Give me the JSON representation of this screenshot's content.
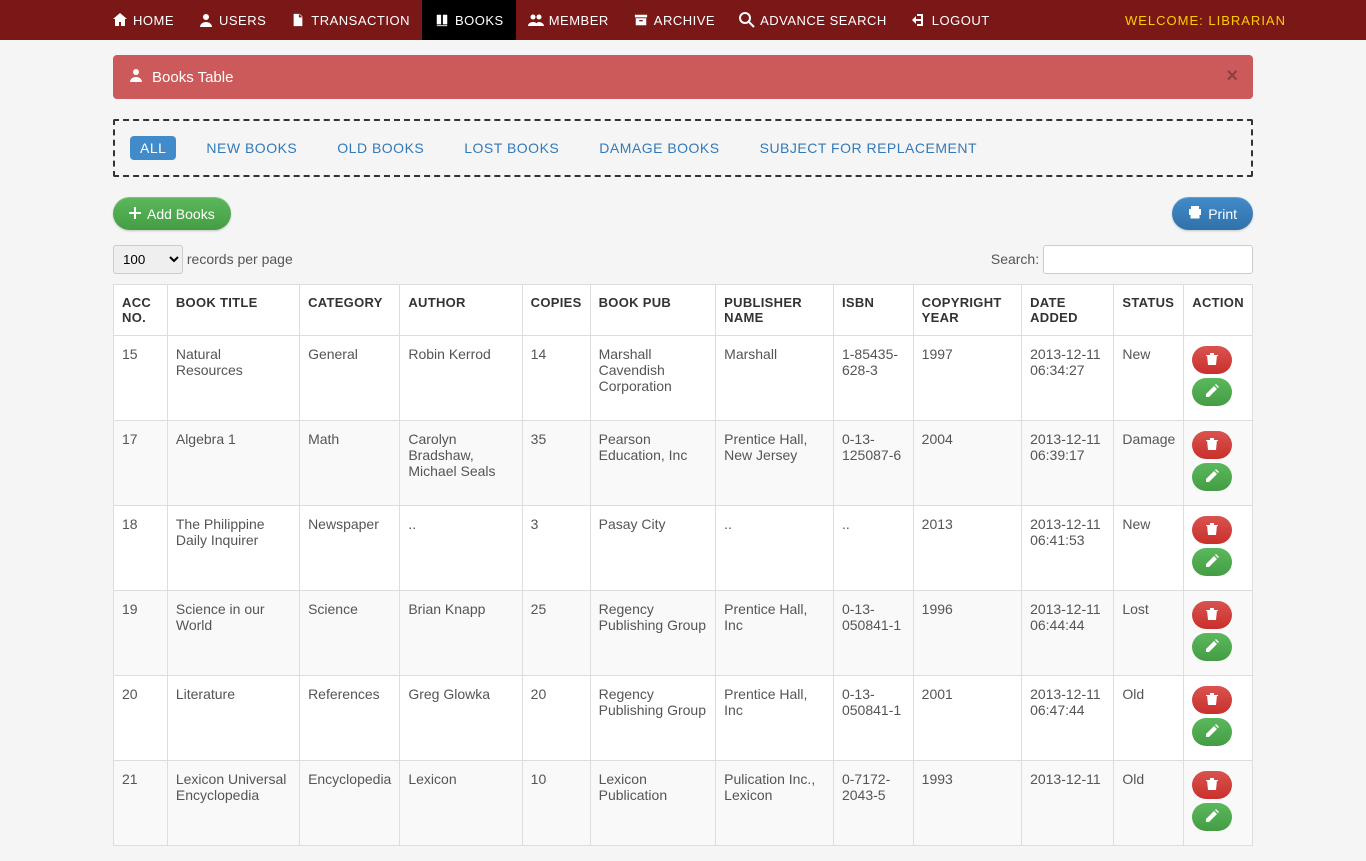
{
  "nav": {
    "home": "HOME",
    "users": "USERS",
    "transaction": "TRANSACTION",
    "books": "BOOKS",
    "member": "MEMBER",
    "archive": "ARCHIVE",
    "advance_search": "ADVANCE SEARCH",
    "logout": "LOGOUT"
  },
  "welcome": "WELCOME: LIBRARIAN",
  "panel_title": "Books Table",
  "filters": {
    "all": "ALL",
    "new_books": "NEW BOOKS",
    "old_books": "OLD BOOKS",
    "lost_books": "LOST BOOKS",
    "damage_books": "DAMAGE BOOKS",
    "subject_replacement": "SUBJECT FOR REPLACEMENT"
  },
  "buttons": {
    "add_books": "Add Books",
    "print": "Print"
  },
  "records_label": "records per page",
  "records_value": "100",
  "search_label": "Search:",
  "columns": {
    "acc_no": "ACC NO.",
    "book_title": "BOOK TITLE",
    "category": "CATEGORY",
    "author": "AUTHOR",
    "copies": "COPIES",
    "book_pub": "BOOK PUB",
    "publisher_name": "PUBLISHER NAME",
    "isbn": "ISBN",
    "copyright_year": "COPYRIGHT YEAR",
    "date_added": "DATE ADDED",
    "status": "STATUS",
    "action": "ACTION"
  },
  "rows": [
    {
      "acc": "15",
      "title": "Natural Resources",
      "cat": "General",
      "author": "Robin Kerrod",
      "copies": "14",
      "pub": "Marshall Cavendish Corporation",
      "pubname": "Marshall",
      "isbn": "1-85435-628-3",
      "year": "1997",
      "date": "2013-12-11 06:34:27",
      "status": "New"
    },
    {
      "acc": "17",
      "title": "Algebra 1",
      "cat": "Math",
      "author": "Carolyn Bradshaw, Michael Seals",
      "copies": "35",
      "pub": "Pearson Education, Inc",
      "pubname": "Prentice Hall, New Jersey",
      "isbn": "0-13-125087-6",
      "year": "2004",
      "date": "2013-12-11 06:39:17",
      "status": "Damage"
    },
    {
      "acc": "18",
      "title": "The Philippine Daily Inquirer",
      "cat": "Newspaper",
      "author": "..",
      "copies": "3",
      "pub": "Pasay City",
      "pubname": "..",
      "isbn": "..",
      "year": "2013",
      "date": "2013-12-11 06:41:53",
      "status": "New"
    },
    {
      "acc": "19",
      "title": "Science in our World",
      "cat": "Science",
      "author": "Brian Knapp",
      "copies": "25",
      "pub": "Regency Publishing Group",
      "pubname": "Prentice Hall, Inc",
      "isbn": "0-13-050841-1",
      "year": "1996",
      "date": "2013-12-11 06:44:44",
      "status": "Lost"
    },
    {
      "acc": "20",
      "title": "Literature",
      "cat": "References",
      "author": "Greg Glowka",
      "copies": "20",
      "pub": "Regency Publishing Group",
      "pubname": "Prentice Hall, Inc",
      "isbn": "0-13-050841-1",
      "year": "2001",
      "date": "2013-12-11 06:47:44",
      "status": "Old"
    },
    {
      "acc": "21",
      "title": "Lexicon Universal Encyclopedia",
      "cat": "Encyclopedia",
      "author": "Lexicon",
      "copies": "10",
      "pub": "Lexicon Publication",
      "pubname": "Pulication Inc., Lexicon",
      "isbn": "0-7172-2043-5",
      "year": "1993",
      "date": "2013-12-11",
      "status": "Old"
    }
  ]
}
